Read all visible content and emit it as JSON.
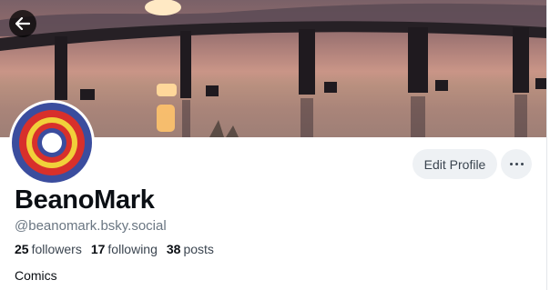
{
  "profile": {
    "display_name": "BeanoMark",
    "handle": "@beanomark.bsky.social",
    "bio": "Comics"
  },
  "stats": {
    "followers_count": "25",
    "followers_label": "followers",
    "following_count": "17",
    "following_label": "following",
    "posts_count": "38",
    "posts_label": "posts"
  },
  "actions": {
    "edit_profile_label": "Edit Profile"
  },
  "icons": {
    "back": "arrow-left-icon",
    "more": "ellipsis-icon"
  },
  "colors": {
    "button_bg": "#eef1f4",
    "text_primary": "#0b0f14",
    "text_secondary": "#6a7682"
  }
}
